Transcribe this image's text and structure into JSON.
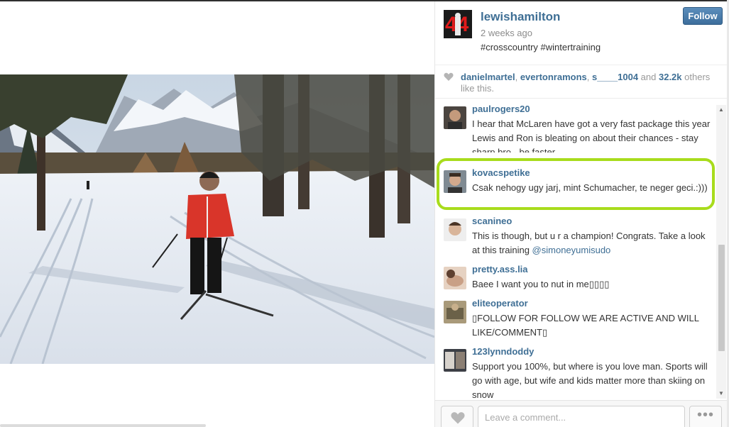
{
  "post": {
    "username": "lewishamilton",
    "time": "2 weeks ago",
    "caption": "#crosscountry #wintertraining",
    "follow_label": "Follow",
    "avatar_text": "44"
  },
  "likes": {
    "user1": "danielmartel",
    "sep1": ", ",
    "user2": "evertonramons",
    "sep2": ", ",
    "user3": "s____1004",
    "and_text": " and ",
    "count": "32.2k",
    "suffix": " others like this."
  },
  "comments": [
    {
      "username": "paulrogers20",
      "text": "I hear that McLaren have got a very fast package this year Lewis and Ron is bleating on about their chances - stay sharp bro - be faster"
    },
    {
      "username": "kovacspetike",
      "text": "Csak nehogy ugy jarj, mint Schumacher, te neger geci.:)))"
    },
    {
      "username": "scanineo",
      "text": "This is though, but u r a champion! Congrats. Take a look at this training ",
      "mention": "@simoneyumisudo"
    },
    {
      "username": "pretty.ass.lia",
      "text": "Baee I want you to nut in me▯▯▯▯"
    },
    {
      "username": "eliteoperator",
      "text": "▯FOLLOW FOR FOLLOW WE ARE ACTIVE AND WILL LIKE/COMMENT▯"
    },
    {
      "username": "123lynndoddy",
      "text": "Support you 100%, but where is you love man. Sports will go with age, but wife and kids matter more than skiing on snow"
    }
  ],
  "footer": {
    "comment_placeholder": "Leave a comment...",
    "more_label": "•••"
  },
  "colors": {
    "link": "#3f6f95",
    "follow_button": "#4a7aa8",
    "highlight": "#a8dc1c"
  }
}
